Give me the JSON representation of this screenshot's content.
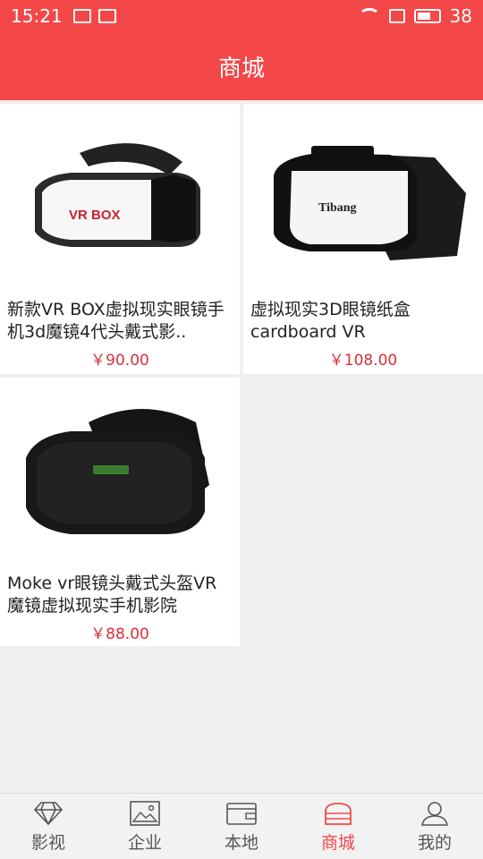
{
  "status_bar": {
    "time": "15:21",
    "battery_level": "38"
  },
  "header": {
    "title": "商城"
  },
  "products": [
    {
      "title": "新款VR BOX虚拟现实眼镜手机3d魔镜4代头戴式影..",
      "price": "￥90.00",
      "brand_text": "VR BOX"
    },
    {
      "title": "虚拟现实3D眼镜纸盒cardboard VR",
      "price": "￥108.00",
      "brand_text": "Tibang"
    },
    {
      "title": "Moke vr眼镜头戴式头盔VR魔镜虚拟现实手机影院",
      "price": "￥88.00",
      "brand_text": ""
    }
  ],
  "bottom_nav": [
    {
      "label": "影视",
      "icon": "diamond-icon"
    },
    {
      "label": "企业",
      "icon": "image-icon"
    },
    {
      "label": "本地",
      "icon": "wallet-icon"
    },
    {
      "label": "商城",
      "icon": "shop-icon",
      "active": true
    },
    {
      "label": "我的",
      "icon": "user-icon"
    }
  ]
}
